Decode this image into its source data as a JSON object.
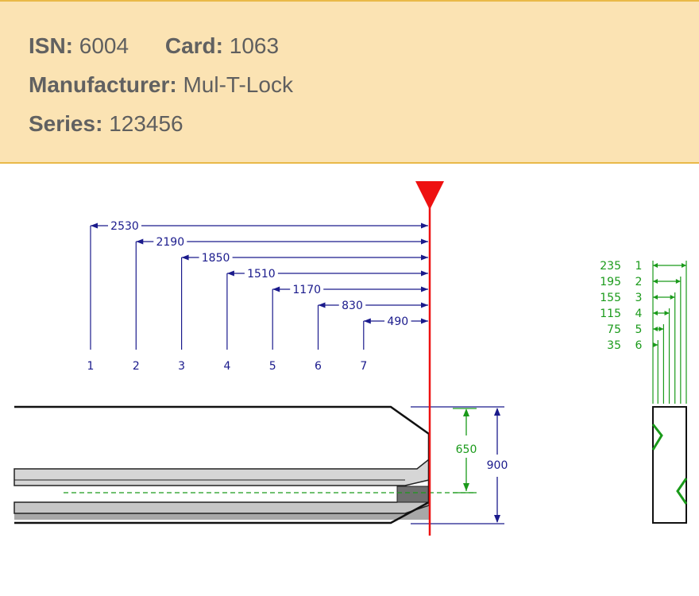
{
  "info": {
    "isn_label": "ISN:",
    "isn_value": "6004",
    "card_label": "Card:",
    "card_value": "1063",
    "manufacturer_label": "Manufacturer:",
    "manufacturer_value": "Mul-T-Lock",
    "series_label": "Series:",
    "series_value": "123456"
  },
  "colors": {
    "card_bg": "#fbe3b3",
    "card_border": "#e9b949",
    "dimension_blue": "#1a1a8c",
    "depth_green": "#1a9a1a",
    "stop_red": "#ee1111"
  },
  "diagram": {
    "cut_positions": [
      {
        "number": "1",
        "distance": "2530"
      },
      {
        "number": "2",
        "distance": "2190"
      },
      {
        "number": "3",
        "distance": "1850"
      },
      {
        "number": "4",
        "distance": "1510"
      },
      {
        "number": "5",
        "distance": "1170"
      },
      {
        "number": "6",
        "distance": "830"
      },
      {
        "number": "7",
        "distance": "490"
      }
    ],
    "blade_dims": {
      "height_inner": "650",
      "height_total": "900"
    },
    "depths": [
      {
        "number": "1",
        "value": "235"
      },
      {
        "number": "2",
        "value": "195"
      },
      {
        "number": "3",
        "value": "155"
      },
      {
        "number": "4",
        "value": "115"
      },
      {
        "number": "5",
        "value": "75"
      },
      {
        "number": "6",
        "value": "35"
      }
    ]
  }
}
